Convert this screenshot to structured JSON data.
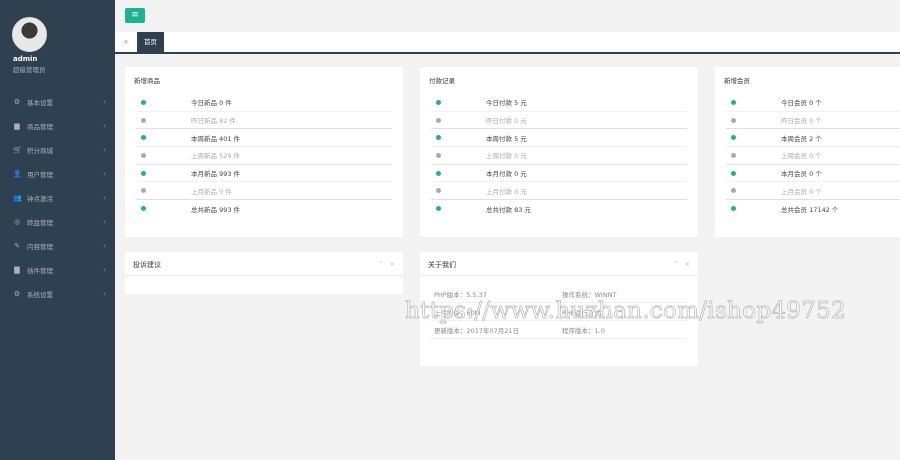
{
  "sidebar": {
    "user_name": "admin",
    "user_role": "超级管理员",
    "items": [
      {
        "label": "基本设置",
        "icon": "gear-icon",
        "glyph": "⚙"
      },
      {
        "label": "商品管理",
        "icon": "folder-icon",
        "glyph": "▆"
      },
      {
        "label": "积分商城",
        "icon": "cart-icon",
        "glyph": "🛒"
      },
      {
        "label": "用户管理",
        "icon": "user-icon",
        "glyph": "👤"
      },
      {
        "label": "钟点激活",
        "icon": "users-icon",
        "glyph": "👥"
      },
      {
        "label": "转盘管理",
        "icon": "compass-icon",
        "glyph": "◎"
      },
      {
        "label": "内容管理",
        "icon": "edit-icon",
        "glyph": "✎"
      },
      {
        "label": "插件管理",
        "icon": "plugin-icon",
        "glyph": "▇"
      },
      {
        "label": "系统设置",
        "icon": "cogs-icon",
        "glyph": "⚙"
      }
    ]
  },
  "topbar": {
    "menu_glyph": "≡"
  },
  "tabs": {
    "back_glyph": "«",
    "home": "首页"
  },
  "panels": {
    "products": {
      "title": "新增商品",
      "rows": [
        {
          "text": "今日新品 0 件",
          "dot": "green",
          "muted": false
        },
        {
          "text": "昨日新品 82 件",
          "dot": "gray",
          "muted": true
        },
        {
          "text": "本周新品 401 件",
          "dot": "green",
          "muted": false
        },
        {
          "text": "上周新品 529 件",
          "dot": "gray",
          "muted": true
        },
        {
          "text": "本月新品 993 件",
          "dot": "green",
          "muted": false
        },
        {
          "text": "上月新品 0 件",
          "dot": "gray",
          "muted": true
        },
        {
          "text": "总共新品 993 件",
          "dot": "green",
          "muted": false
        }
      ]
    },
    "payments": {
      "title": "付款记录",
      "rows": [
        {
          "text": "今日付款 5 元",
          "dot": "green",
          "muted": false
        },
        {
          "text": "昨日付款 0 元",
          "dot": "gray",
          "muted": true
        },
        {
          "text": "本周付款 5 元",
          "dot": "green",
          "muted": false
        },
        {
          "text": "上周付款 0 元",
          "dot": "gray",
          "muted": true
        },
        {
          "text": "本月付款 0 元",
          "dot": "green",
          "muted": false
        },
        {
          "text": "上月付款 0 元",
          "dot": "gray",
          "muted": true
        },
        {
          "text": "总共付款 83 元",
          "dot": "green",
          "muted": false
        }
      ]
    },
    "members": {
      "title": "新增会员",
      "rows": [
        {
          "text": "今日会员 0 个",
          "dot": "green",
          "muted": false
        },
        {
          "text": "昨日会员 0 个",
          "dot": "gray",
          "muted": true
        },
        {
          "text": "本周会员 2 个",
          "dot": "green",
          "muted": false
        },
        {
          "text": "上周会员 0 个",
          "dot": "gray",
          "muted": true
        },
        {
          "text": "本月会员 0 个",
          "dot": "green",
          "muted": false
        },
        {
          "text": "上月会员 0 个",
          "dot": "gray",
          "muted": true
        },
        {
          "text": "总共会员 17142 个",
          "dot": "green",
          "muted": false
        }
      ]
    },
    "feedback": {
      "title": "投诉建议",
      "collapse_glyph": "⌃",
      "close_glyph": "×"
    },
    "about": {
      "title": "关于我们",
      "collapse_glyph": "⌃",
      "close_glyph": "×",
      "rows": [
        [
          "PHP版本：5.5.37",
          "操作系统：WINNT"
        ],
        [
          "上传附件：60M",
          "PHP运行方式：..."
        ],
        [
          "更新版本：2017年07月21日",
          "程序版本：1.0"
        ]
      ]
    }
  },
  "watermark": "https://www.huzhan.com/ishop49752",
  "colors": {
    "sidebar": "#2f4050",
    "accent": "#1ab394",
    "background": "#f3f3f4"
  }
}
